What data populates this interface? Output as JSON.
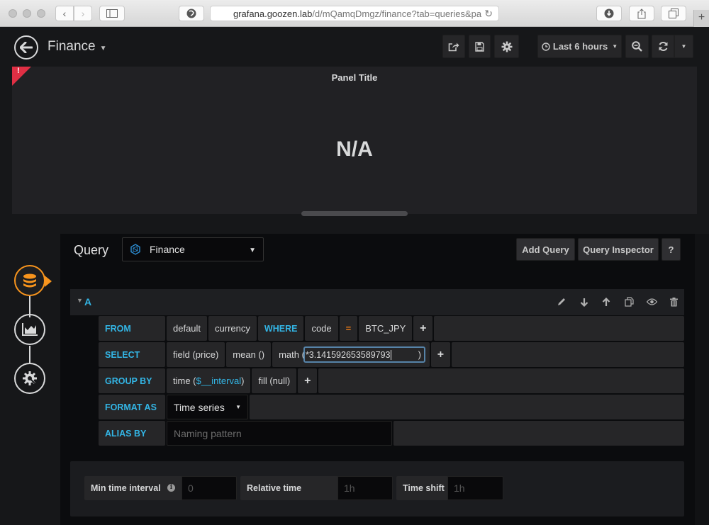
{
  "browser": {
    "url_host": "grafana.goozen.lab",
    "url_path": "/d/mQamqDmgz/finance?tab=queries&pa",
    "new_tab_label": "+"
  },
  "nav": {
    "dashboard_title": "Finance",
    "time_picker_label": "Last 6 hours"
  },
  "panel": {
    "title": "Panel Title",
    "value": "N/A",
    "error_marker": "!",
    "error_color": "#e02f44"
  },
  "editor": {
    "query_label": "Query",
    "datasource": "Finance",
    "add_query_label": "Add Query",
    "query_inspector_label": "Query Inspector",
    "help_label": "?",
    "accent_color": "#33b5e5",
    "step_active_color": "#f7941d"
  },
  "query_a": {
    "ref_id": "A",
    "from": {
      "key": "FROM",
      "policy": "default",
      "measurement": "currency",
      "where_label": "WHERE",
      "tag_key": "code",
      "operator": "=",
      "tag_value": "BTC_JPY",
      "add": "+"
    },
    "select": {
      "key": "SELECT",
      "field": "field (price)",
      "aggregation": "mean ()",
      "math_label": "math (",
      "math_value": "*3.141592653589793",
      "math_close": ")",
      "add": "+"
    },
    "group_by": {
      "key": "GROUP BY",
      "time_prefix": "time (",
      "time_var": "$__interval",
      "time_suffix": ")",
      "fill": "fill (null)",
      "add": "+"
    },
    "format_as": {
      "key": "FORMAT AS",
      "value": "Time series"
    },
    "alias_by": {
      "key": "ALIAS BY",
      "placeholder": "Naming pattern"
    }
  },
  "options": {
    "min_interval_label": "Min time interval",
    "min_interval_placeholder": "0",
    "relative_time_label": "Relative time",
    "relative_time_placeholder": "1h",
    "time_shift_label": "Time shift",
    "time_shift_placeholder": "1h"
  }
}
